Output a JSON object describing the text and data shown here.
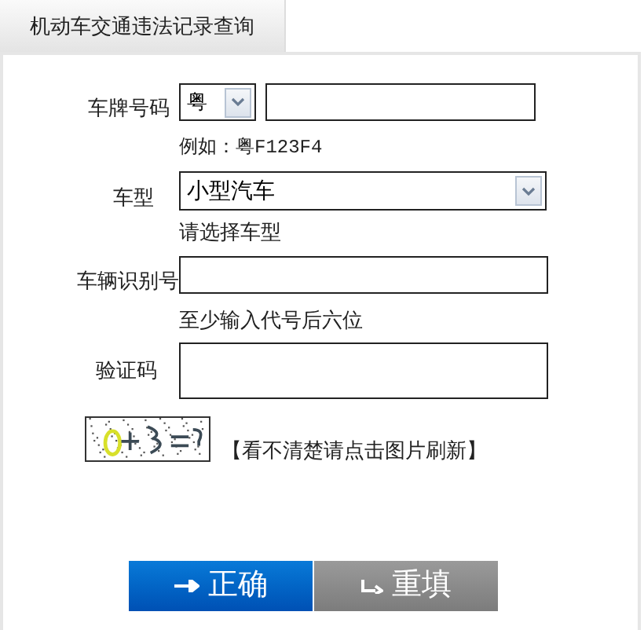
{
  "tab": {
    "label": "机动车交通违法记录查询",
    "selected": true
  },
  "form": {
    "plate": {
      "label": "车牌号码",
      "province": "粤",
      "hint": "例如：粤F123F4"
    },
    "vehicle_type": {
      "label": "车型",
      "value": "小型汽车",
      "hint": "请选择车型"
    },
    "vin": {
      "label": "车辆识别号",
      "hint": "至少输入代号后六位"
    },
    "captcha": {
      "label": "验证码",
      "refresh_hint": "【看不清楚请点击图片刷新】"
    }
  },
  "buttons": [
    {
      "label": "正确",
      "kind": "submit"
    },
    {
      "label": "重填",
      "kind": "reset"
    }
  ]
}
